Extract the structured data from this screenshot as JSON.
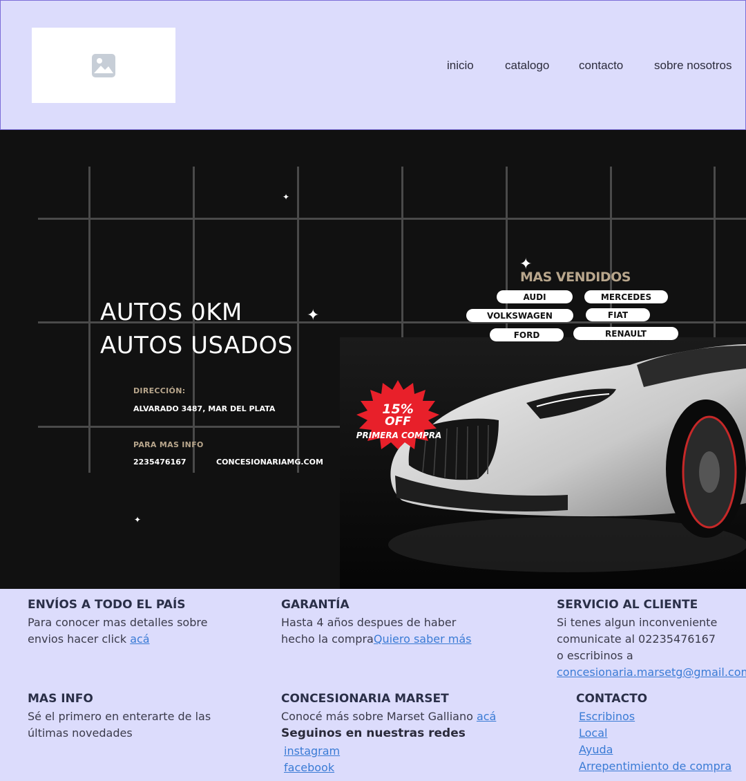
{
  "header": {
    "logo_icon": "image-placeholder-icon",
    "nav": [
      "inicio",
      "catalogo",
      "contacto",
      "sobre nosotros"
    ]
  },
  "hero": {
    "title_line1": "AUTOS 0KM",
    "title_line2": "AUTOS USADOS",
    "direccion_label": "DIRECCIÓN:",
    "direccion_value": "ALVARADO 3487, MAR DEL PLATA",
    "info_label": "PARA MAS INFO",
    "phone": "2235476167",
    "website": "CONCESIONARIAMG.COM",
    "mas_vendidos": "MAS VENDIDOS",
    "brands": [
      "AUDI",
      "MERCEDES",
      "VOLKSWAGEN",
      "FIAT",
      "FORD",
      "RENAULT"
    ],
    "offer_line1": "15%",
    "offer_line2": "OFF",
    "offer_line3": "PRIMERA COMPRA"
  },
  "info": {
    "envios": {
      "title": "ENVÍOS A TODO EL PAÍS",
      "text_line1": "Para conocer mas detalles sobre",
      "text_line2": "envios hacer click ",
      "link": "acá"
    },
    "garantia": {
      "title": "GARANTÍA",
      "text_line1": "Hasta 4 años despues de haber",
      "text_line2": "hecho la compra",
      "link": "Quiero saber más"
    },
    "servicio": {
      "title": "SERVICIO AL CLIENTE",
      "text_line1": "Si tenes algun inconveniente",
      "text_line2": "comunicate al 02235476167",
      "text_line3": "o escribinos a",
      "email": "concesionaria.marsetg@gmail.com"
    },
    "mas_info": {
      "title": "MAS INFO",
      "text_line1": "Sé el primero en enterarte de las",
      "text_line2": "últimas novedades"
    },
    "concesionaria": {
      "title": "CONCESIONARIA MARSET",
      "text": "Conocé más sobre Marset Galliano ",
      "link": "acá",
      "redes_title": "Seguinos en nuestras redes",
      "redes": [
        "instagram",
        "facebook"
      ]
    },
    "contacto": {
      "title": "CONTACTO",
      "links": [
        "Escribinos",
        "Local",
        "Ayuda",
        "Arrepentimiento de compra"
      ]
    }
  },
  "colors": {
    "background": "#dcdcfc",
    "hero_bg": "#111111",
    "accent_gold": "#b8a68c",
    "link_blue": "#3a7bd5",
    "offer_red": "#e8202a"
  }
}
